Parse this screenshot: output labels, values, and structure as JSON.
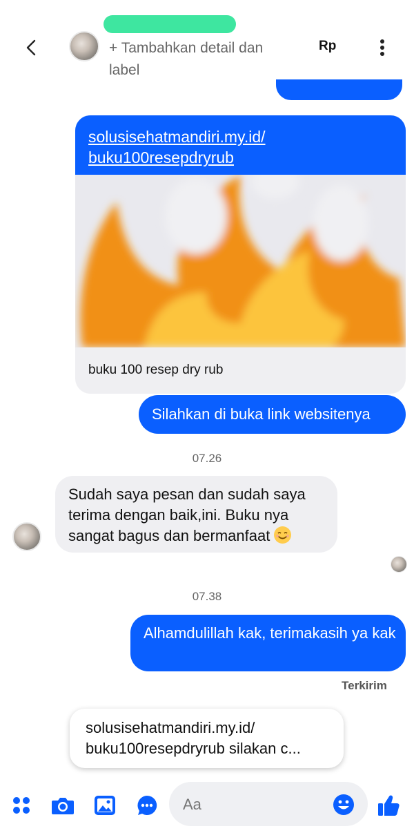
{
  "header": {
    "contact_name_visible": "",
    "add_label_link": "+ Tambahkan detail dan label",
    "currency_button": "Rp",
    "icons": {
      "back": "back-arrow-icon",
      "more": "more-vertical-icon"
    }
  },
  "conversation": {
    "link_card": {
      "url": "solusisehatmandiri.my.id/ buku100resepdryrub",
      "preview_title": "buku 100 resep dry rub",
      "image": "fire-emoji-preview"
    },
    "messages": [
      {
        "id": "m1",
        "direction": "sent",
        "text": "Silahkan di buka link websitenya"
      },
      {
        "id": "m2",
        "direction": "received",
        "text": "Sudah saya pesan dan sudah saya terima dengan baik,ini. Buku nya sangat bagus dan bermanfaat",
        "emoji": "smiling-face-icon"
      },
      {
        "id": "m3",
        "direction": "sent",
        "text": "Alhamdulillah kak, terimakasih ya kak",
        "status": "Terkirim"
      }
    ],
    "timestamps": [
      "07.26",
      "07.38"
    ],
    "suggested_reply": "solusisehatmandiri.my.id/ buku100resepdryrub silakan c..."
  },
  "composer": {
    "placeholder": "Aa",
    "icons": [
      "apps-grid-icon",
      "camera-icon",
      "gallery-icon",
      "chat-extension-icon",
      "emoji-icon",
      "thumbs-up-icon"
    ]
  },
  "colors": {
    "accent": "#0a5fff",
    "received_bubble": "#efeff2",
    "scribble": "#3ee6a0"
  }
}
